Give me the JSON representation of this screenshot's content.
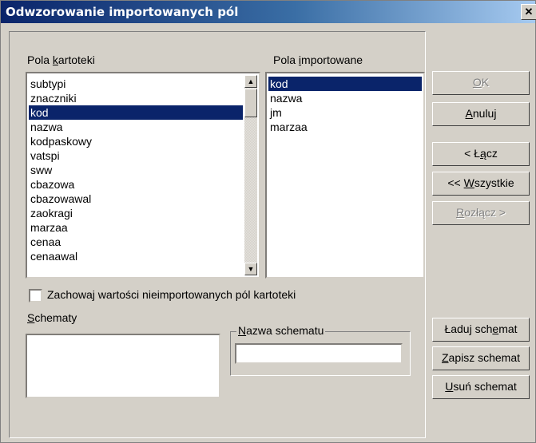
{
  "window": {
    "title": "Odwzorowanie importowanych pól"
  },
  "left_list": {
    "label_pre": "Pola ",
    "label_u": "k",
    "label_post": "artoteki",
    "items": [
      "subtypi",
      "znaczniki",
      "kod",
      "nazwa",
      "kodpaskowy",
      "vatspi",
      "sww",
      "cbazowa",
      "cbazowawal",
      "zaokragi",
      "marzaa",
      "cenaa",
      "cenaawal"
    ],
    "selected_index": 2
  },
  "right_list": {
    "label_pre": "Pola ",
    "label_u": "i",
    "label_post": "mportowane",
    "items": [
      "kod",
      "nazwa",
      "jm",
      "marzaa"
    ],
    "selected_index": 0
  },
  "checkbox": {
    "label": "Zachowaj wartości nieimportowanych pól kartoteki",
    "checked": false
  },
  "schematy": {
    "label_u": "S",
    "label_post": "chematy"
  },
  "nazwa_schematu": {
    "label_u": "N",
    "label_post": "azwa schematu",
    "value": ""
  },
  "buttons": {
    "ok": {
      "u": "O",
      "post": "K"
    },
    "anuluj": {
      "u": "A",
      "post": "nuluj"
    },
    "lacz": {
      "pre": "< Ł",
      "u": "ą",
      "post": "cz"
    },
    "wszystkie": {
      "pre": "<< ",
      "u": "W",
      "post": "szystkie"
    },
    "rozlacz": {
      "u": "R",
      "post": "ozłącz >"
    },
    "laduj": {
      "pre": "Ładuj sch",
      "u": "e",
      "post": "mat"
    },
    "zapisz": {
      "u": "Z",
      "post": "apisz schemat"
    },
    "usun": {
      "u": "U",
      "post": "suń schemat"
    }
  }
}
